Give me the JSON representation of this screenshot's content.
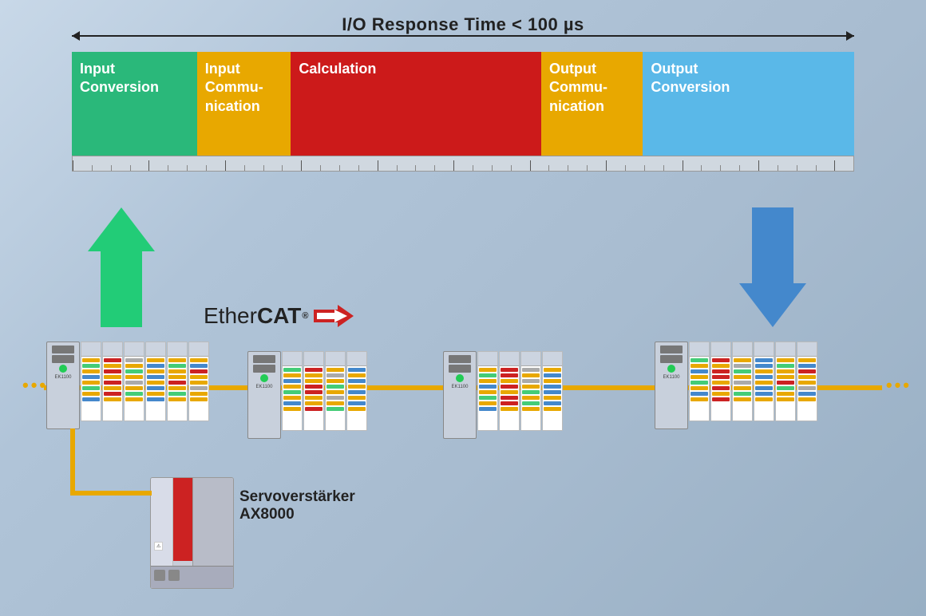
{
  "header": {
    "title": "I/O Response Time < 100 µs"
  },
  "timeline": {
    "blocks": [
      {
        "id": "input-conv",
        "label": "Input\nConversion",
        "color": "#2ab87a",
        "widthPct": 16
      },
      {
        "id": "input-comm",
        "label": "Input\nCommu-\nnication",
        "color": "#e8a800",
        "widthPct": 12
      },
      {
        "id": "calculation",
        "label": "Calculation",
        "color": "#cc1a1a",
        "widthPct": 32
      },
      {
        "id": "output-comm",
        "label": "Output\nCommu-\nnication",
        "color": "#e8a800",
        "widthPct": 13
      },
      {
        "id": "output-conv",
        "label": "Output\nConversion",
        "color": "#5ab8e8",
        "widthPct": 27
      }
    ]
  },
  "labels": {
    "ethercat": "EtherCAT",
    "servo_name": "Servoverstärker",
    "servo_model": "AX8000"
  },
  "arrows": {
    "up_color": "#22cc77",
    "down_color": "#4488cc"
  },
  "network": {
    "line_color": "#e8a800",
    "dot_char": "• • •"
  }
}
